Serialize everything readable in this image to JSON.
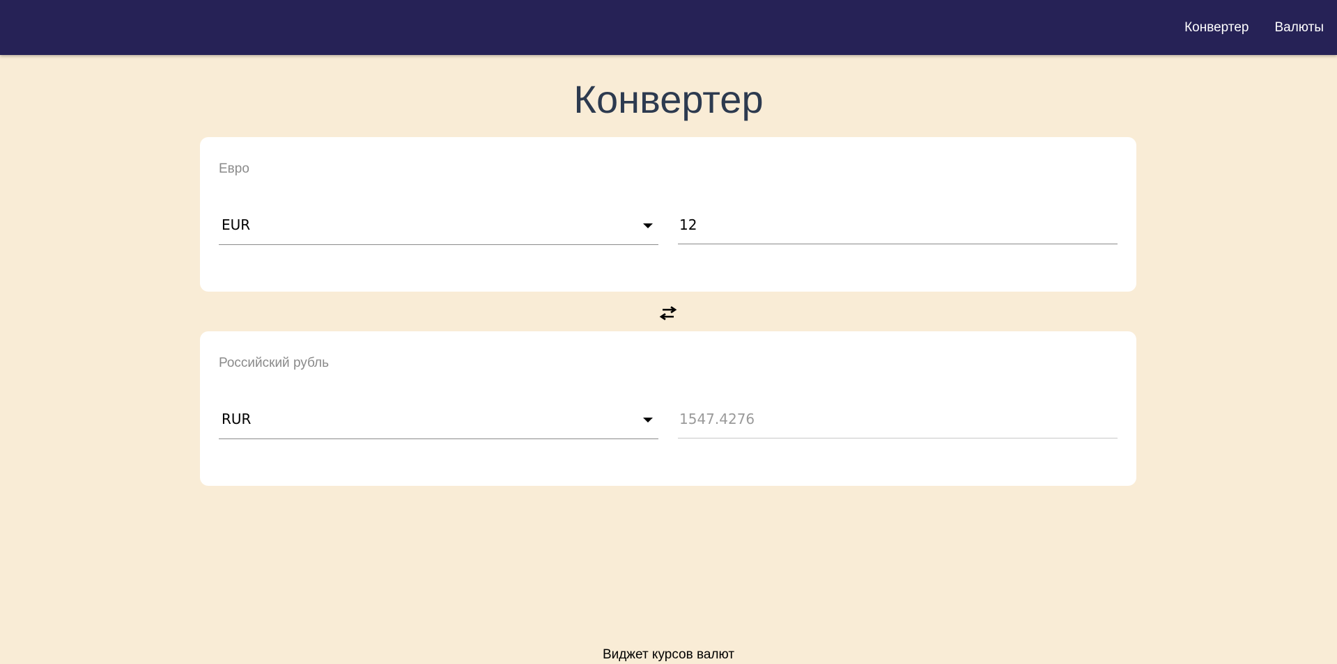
{
  "nav": {
    "converter": "Конвертер",
    "currencies": "Валюты"
  },
  "page": {
    "title": "Конвертер"
  },
  "from": {
    "label": "Евро",
    "currency": "EUR",
    "amount": "12"
  },
  "to": {
    "label": "Российский рубль",
    "currency": "RUR",
    "amount": "1547.4276"
  },
  "footer": {
    "text": "Виджет курсов валют"
  },
  "colors": {
    "header": "#262256",
    "background": "#f9ecd6",
    "card": "#ffffff",
    "title": "#2d3a4f"
  },
  "icons": {
    "swap": "swap-arrows-icon",
    "dropdown": "caret-down-icon"
  }
}
